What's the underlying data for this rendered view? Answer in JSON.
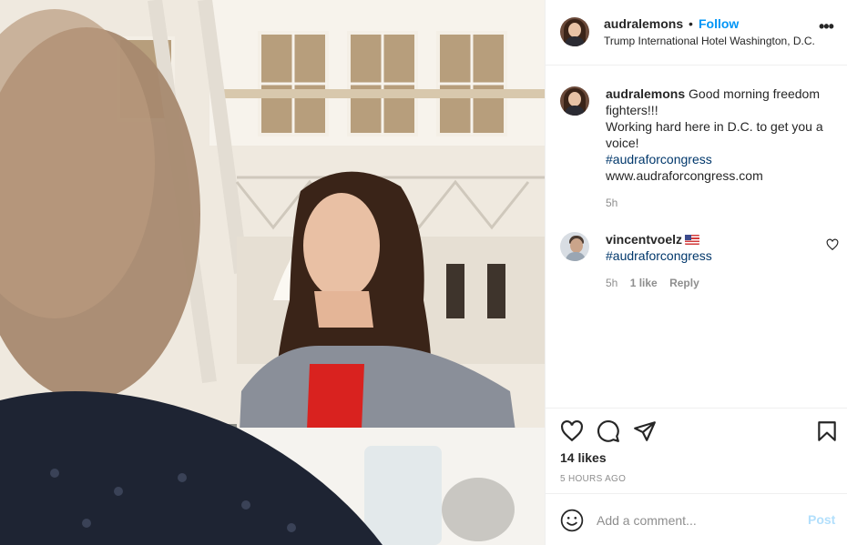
{
  "post": {
    "author": "audralemons",
    "separator": "•",
    "follow_label": "Follow",
    "location": "Trump International Hotel Washington, D.C.",
    "more_icon": "more-horizontal-icon"
  },
  "caption": {
    "username": "audralemons",
    "line1": "Good morning freedom fighters!!!",
    "line2": "Working hard here in D.C. to get you a voice!",
    "hashtag": "#audraforcongress",
    "website": "www.audraforcongress.com",
    "time": "5h"
  },
  "comments": [
    {
      "username": "vincentvoelz",
      "emoji": "US flag",
      "text": "#audraforcongress",
      "time": "5h",
      "likes": "1 like",
      "reply_label": "Reply"
    }
  ],
  "actions": {
    "icons": [
      "heart-icon",
      "comment-icon",
      "share-icon",
      "bookmark-icon"
    ],
    "likes": "14 likes",
    "posted": "5 HOURS AGO"
  },
  "add_comment": {
    "placeholder": "Add a comment...",
    "post_label": "Post",
    "post_color": "#b2dffc"
  },
  "colors": {
    "link": "#0095f6",
    "hashtag": "#00376b",
    "muted": "#8e8e8e"
  }
}
